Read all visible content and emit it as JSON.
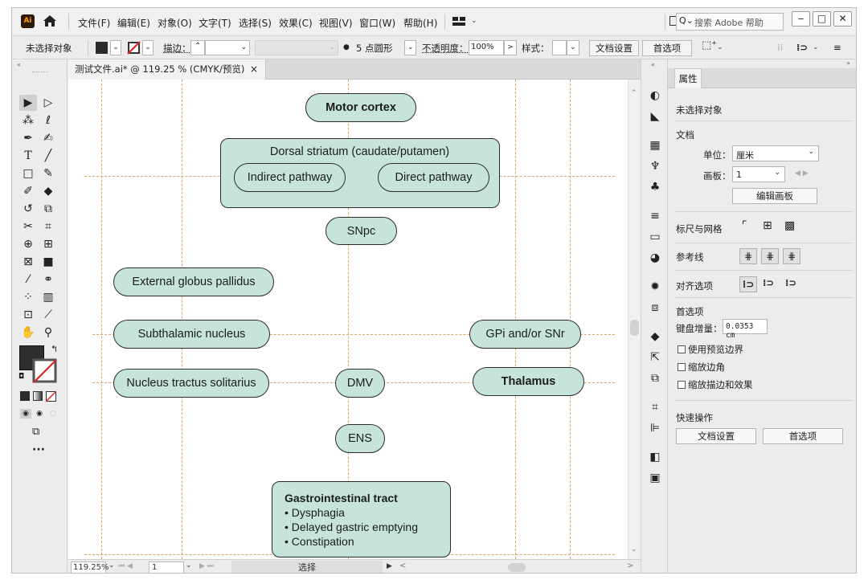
{
  "menubar": {
    "logo": "Ai",
    "items": [
      "文件(F)",
      "编辑(E)",
      "对象(O)",
      "文字(T)",
      "选择(S)",
      "效果(C)",
      "视图(V)",
      "窗口(W)",
      "帮助(H)"
    ],
    "search_placeholder": "搜索 Adobe 帮助"
  },
  "controlbar": {
    "selection": "未选择对象",
    "stroke_label": "描边：",
    "brush": "5 点圆形",
    "opacity_label": "不透明度：",
    "opacity_value": "100%",
    "style_label": "样式：",
    "doc_setup": "文档设置",
    "preferences": "首选项"
  },
  "document": {
    "tab_title": "测试文件.ai* @ 119.25 % (CMYK/预览)",
    "tab_close": "×"
  },
  "diagram": {
    "motor_cortex": "Motor cortex",
    "dorsal_striatum": "Dorsal striatum (caudate/putamen)",
    "indirect": "Indirect pathway",
    "direct": "Direct pathway",
    "snpc": "SNpc",
    "external_gp": "External globus pallidus",
    "subthalamic": "Subthalamic nucleus",
    "gpi_snr": "GPi and/or SNr",
    "nts": "Nucleus tractus solitarius",
    "dmv": "DMV",
    "thalamus": "Thalamus",
    "ens": "ENS",
    "gi_title": "Gastrointestinal tract",
    "gi_items": [
      "• Dysphagia",
      "• Delayed gastric emptying",
      "• Constipation"
    ]
  },
  "statusbar": {
    "zoom": "119.25%",
    "artboard": "1",
    "mode": "选择"
  },
  "properties": {
    "tab": "属性",
    "no_selection": "未选择对象",
    "document_section": "文档",
    "units_label": "单位：",
    "units_value": "厘米",
    "artboard_label": "画板：",
    "artboard_value": "1",
    "edit_artboards": "编辑画板",
    "rulers_grids": "标尺与网格",
    "guides": "参考线",
    "align_options": "对齐选项",
    "preferences_section": "首选项",
    "keyboard_increment_label": "键盘增量：",
    "keyboard_increment_value": "0.0353 cm",
    "checkboxes": [
      "使用预览边界",
      "缩放边角",
      "缩放描边和效果"
    ],
    "quick_actions": "快速操作",
    "btn_doc_setup": "文档设置",
    "btn_preferences": "首选项"
  }
}
